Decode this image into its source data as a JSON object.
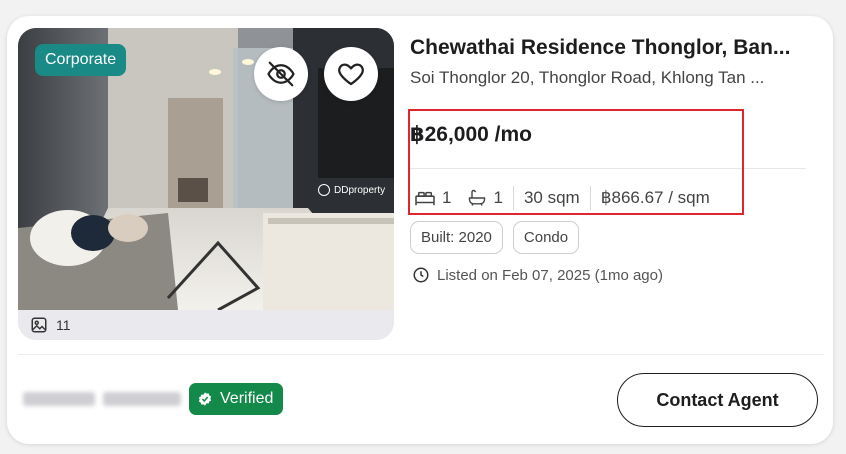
{
  "listing": {
    "badge": "Corporate",
    "photo_count": "11",
    "watermark": "DDproperty",
    "title": "Chewathai Residence Thonglor, Ban...",
    "address": "Soi Thonglor 20, Thonglor Road, Khlong Tan ...",
    "price": "฿26,000 /mo",
    "bedrooms": "1",
    "bathrooms": "1",
    "area": "30 sqm",
    "price_per_sqm": "฿866.67 / sqm",
    "tags": [
      "Built: 2020",
      "Condo"
    ],
    "listed": "Listed on Feb 07, 2025 (1mo ago)"
  },
  "agent": {
    "verified_label": "Verified"
  },
  "actions": {
    "contact_label": "Contact Agent"
  },
  "icons": {
    "hide": "eye-off-icon",
    "favorite": "heart-icon",
    "gallery": "image-gallery-icon",
    "bed": "bed-icon",
    "bath": "bathtub-icon",
    "clock": "clock-icon",
    "verified": "verified-badge-icon"
  },
  "colors": {
    "corporate_badge": "#1a8a86",
    "verified_badge": "#138a4a",
    "highlight_box": "#e0262b"
  }
}
